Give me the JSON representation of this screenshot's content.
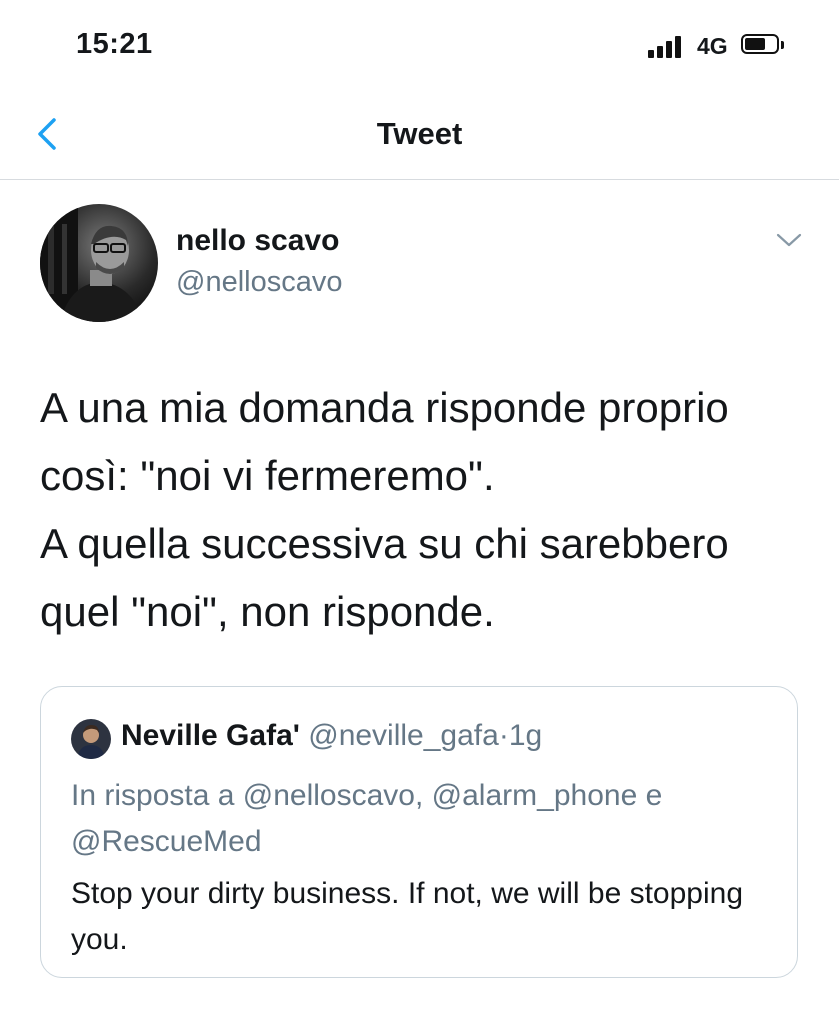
{
  "status_bar": {
    "time": "15:21",
    "network": "4G",
    "signal_bars": 4,
    "battery_level": 0.65
  },
  "nav": {
    "title": "Tweet",
    "back_icon": "chevron-left-icon",
    "accent_color": "#1da1f2"
  },
  "tweet": {
    "author_name": "nello scavo",
    "author_handle": "@nelloscavo",
    "text": "A una mia domanda risponde proprio così: \"noi vi fermeremo\".\nA quella successiva su chi sarebbero quel \"noi\", non risponde.",
    "menu_icon": "chevron-down-icon"
  },
  "quoted_tweet": {
    "author_name": "Neville Gafa'",
    "author_handle": "@neville_gafa",
    "separator": "·",
    "time": "1g",
    "reply_prefix": "In risposta a",
    "reply_mention_1": "@nelloscavo",
    "reply_separator": ",",
    "reply_mention_2": "@alarm_phone",
    "reply_conjunction": "e",
    "reply_mention_3": "@RescueMed",
    "text": "Stop your dirty business. If not, we will be stopping you."
  },
  "colors": {
    "text_primary": "#14171a",
    "text_secondary": "#657786",
    "border": "#ccd6dd"
  }
}
